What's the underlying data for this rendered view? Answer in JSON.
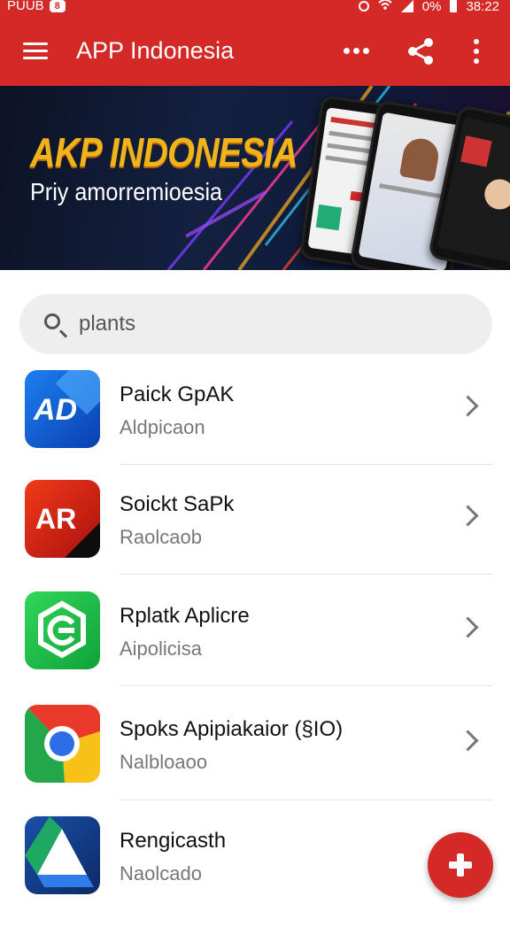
{
  "status_bar": {
    "left_text": "PUUB",
    "notif": "8",
    "right_text": "0%",
    "time": "38:22"
  },
  "app_bar": {
    "title": "APP Indonesia",
    "icons": [
      "menu-icon",
      "more-horizontal-icon",
      "share-icon",
      "more-vertical-icon"
    ]
  },
  "banner": {
    "title": "AKP INDONESIA",
    "subtitle": "Priy amorremioesia"
  },
  "search": {
    "value": "plants",
    "icon": "search-icon"
  },
  "apps": [
    {
      "name": "Paick GpAK",
      "subtitle": "Aldpicaon",
      "icon_text": "AD"
    },
    {
      "name": "Soickt SaPk",
      "subtitle": "Raolcaob",
      "icon_text": "AR"
    },
    {
      "name": "Rplatk Aplicre",
      "subtitle": "Aipolicisa",
      "icon_text": ""
    },
    {
      "name": "Spoks Apipiakaior (§IO)",
      "subtitle": "Nalbloaoo",
      "icon_text": ""
    },
    {
      "name": "Rengicasth",
      "subtitle": "Naolcado",
      "icon_text": ""
    }
  ],
  "colors": {
    "brand_red": "#d32a27",
    "banner_title": "#f0b41a"
  },
  "fab_icon": "plus-icon"
}
